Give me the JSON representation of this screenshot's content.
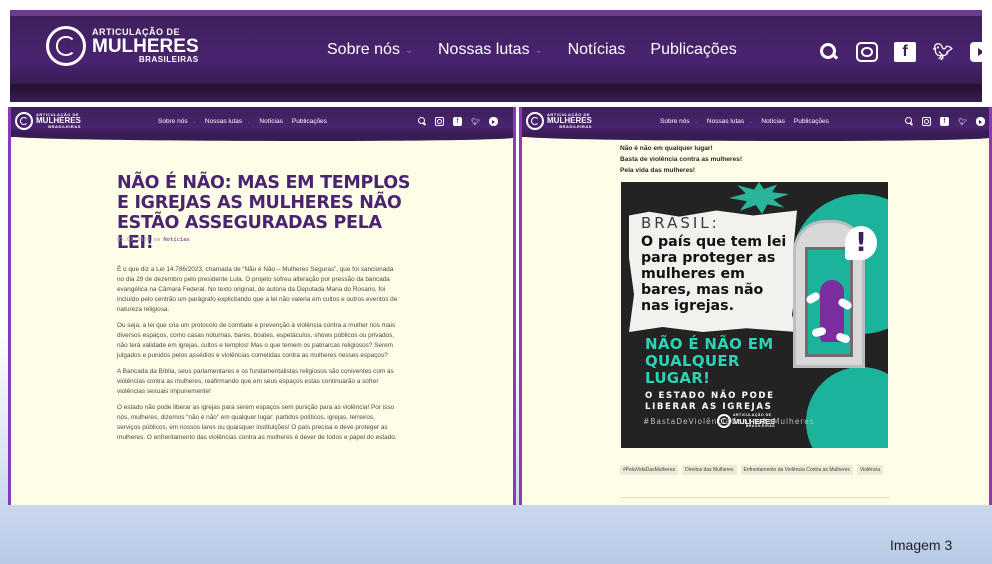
{
  "site": {
    "logo": {
      "line1": "ARTICULAÇÃO DE",
      "line2": "MULHERES",
      "line3": "BRASILEIRAS"
    },
    "nav": [
      {
        "label": "Sobre nós",
        "has_dropdown": true
      },
      {
        "label": "Nossas lutas",
        "has_dropdown": true
      },
      {
        "label": "Notícias",
        "has_dropdown": false
      },
      {
        "label": "Publicações",
        "has_dropdown": false
      }
    ],
    "dropdown_glyph": "⌄",
    "social_icons": [
      "search-icon",
      "instagram-icon",
      "facebook-icon",
      "twitter-icon",
      "youtube-icon"
    ],
    "colors": {
      "header": "#4a2470",
      "accent": "#c44bd1",
      "page_bg": "#fefde8",
      "poster_teal": "#1bb49a"
    }
  },
  "article": {
    "title": "Não é não: mas em templos e igrejas as mulheres não estão asseguradas pela lei!",
    "date": "05.01.2024",
    "date_sep": "em",
    "category": "Notícias",
    "paragraphs": [
      "É o que diz a Lei 14.786/2023, chamada de “Não é Não – Mulheres Seguras”, que foi sancionada no dia 29 de dezembro pelo presidente Lula. O projeto sofreu alteração por pressão da bancada evangélica na Câmara Federal. No texto original, de autoria da Deputada Maria do Rosario, foi incluído pelo centrão um parágrafo explicitando que a lei não valeria em cultos e outros eventos de natureza religiosa.",
      "Ou seja, a lei que cria um protocolo de combate e prevenção à violência contra a mulher nos mais diversos espaços, como casas noturnas, bares, boates, espetáculos, shows públicos ou privados, não terá validade em igrejas, cultos e templos! Mas o que temem os patriarcas religiosos? Serem julgados e punidos pelos assédios e violências cometidas contra as mulheres nesses espaços?",
      "A Bancada da Bíblia, seus parlamentares e os fundamentalistas religiosos são coniventes com as violências contra as mulheres, reafirmando que em seus espaços estas continuarão a sofrer violências sexuais impunemente!",
      "O estado não pode liberar as igrejas para serem espaços sem punição para as violência! Por isso nós, mulheres, dizemos “não é não” em qualquer lugar: partidos políticos, igrejas, terreiros, serviços públicos, em nossos lares ou quaisquer instituições! O país precisa e deve proteger as mulheres. O enfrentamento das violências contra as mulheres é dever de todos e papel do estado."
    ]
  },
  "right_article": {
    "lines": [
      "Não é não em qualquer lugar!",
      "Basta de violência contra as mulheres!",
      "Pela vida das mulheres!"
    ],
    "poster": {
      "brasil": "BRASIL:",
      "main": "O país que tem lei para proteger as mulheres em bares, mas não nas igrejas.",
      "nao": "NÃO É NÃO EM QUALQUER LUGAR!",
      "estado": "O ESTADO NÃO PODE LIBERAR AS IGREJAS",
      "hashtag": "#BastaDeViolênciaContraAsMulheres",
      "exclamation": "!"
    },
    "tags": [
      "#PelaVidaDasMulheres",
      "Direitos das Mulheres",
      "Enfrentamento da Violência Contra as Mulheres",
      "Violência"
    ]
  },
  "caption": "Imagem 3"
}
